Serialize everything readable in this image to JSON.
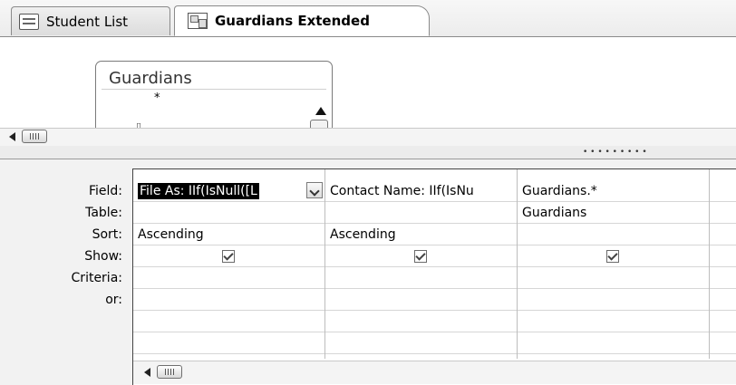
{
  "tabs": [
    {
      "label": "Student List",
      "icon": "form-icon",
      "active": false
    },
    {
      "label": "Guardians Extended",
      "icon": "query-icon",
      "active": true
    }
  ],
  "table_box": {
    "title": "Guardians",
    "fields": [
      "*"
    ]
  },
  "row_labels": [
    "Field:",
    "Table:",
    "Sort:",
    "Show:",
    "Criteria:",
    "or:"
  ],
  "columns": [
    {
      "field": "File As: IIf(IsNull([L",
      "table": "",
      "sort": "Ascending",
      "show": true,
      "criteria": "",
      "or": ""
    },
    {
      "field": "Contact Name: IIf(IsNu",
      "table": "",
      "sort": "Ascending",
      "show": true,
      "criteria": "",
      "or": ""
    },
    {
      "field": "Guardians.*",
      "table": "Guardians",
      "sort": "",
      "show": true,
      "criteria": "",
      "or": ""
    }
  ],
  "colors": {
    "selection_bg": "#000000",
    "selection_fg": "#ffffff",
    "gridline": "#d6d6d6"
  }
}
